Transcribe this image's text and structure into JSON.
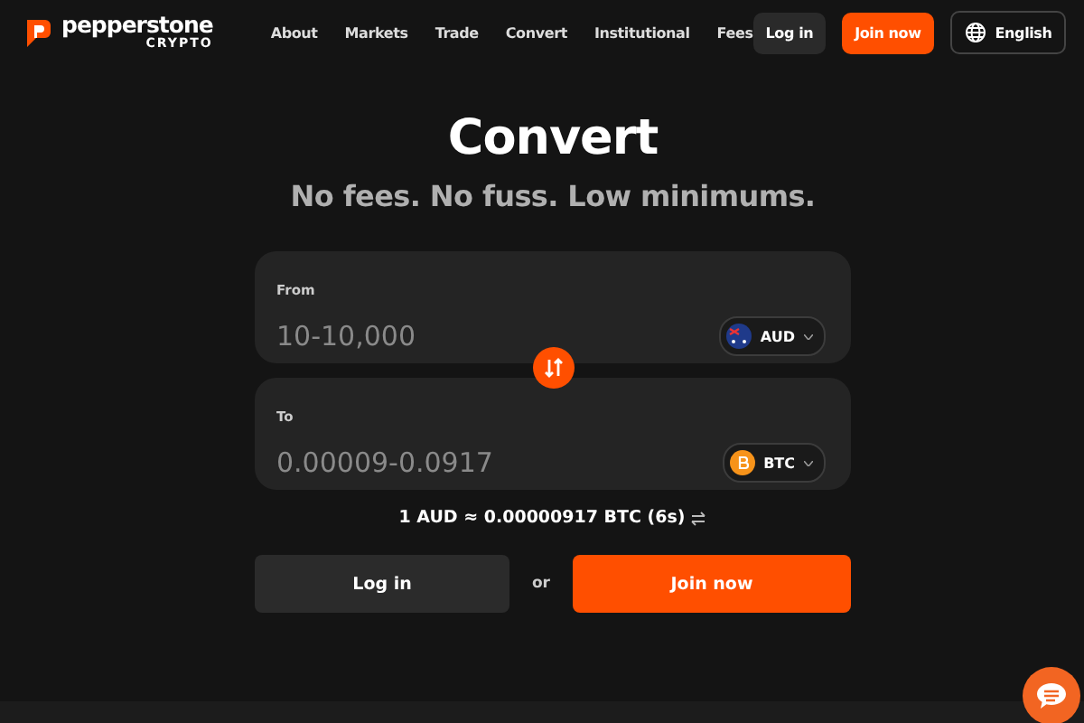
{
  "header": {
    "logo_name": "pepperstone",
    "logo_sub": "CRYPTO",
    "nav": [
      "About",
      "Markets",
      "Trade",
      "Convert",
      "Institutional",
      "Fees"
    ],
    "login": "Log in",
    "join": "Join now",
    "language": "English"
  },
  "title": "Convert",
  "subtitle": "No fees. No fuss. Low minimums.",
  "fields": [
    {
      "label": "From",
      "placeholder": "10-10,000",
      "currency": "AUD",
      "kind": "flag"
    },
    {
      "label": "To",
      "placeholder": "0.00009-0.0917",
      "currency": "BTC",
      "kind": "coin"
    }
  ],
  "rate": "1 AUD ≈ 0.00000917 BTC (6s)",
  "actions": {
    "login": "Log in",
    "separator": "or",
    "join": "Join now"
  }
}
